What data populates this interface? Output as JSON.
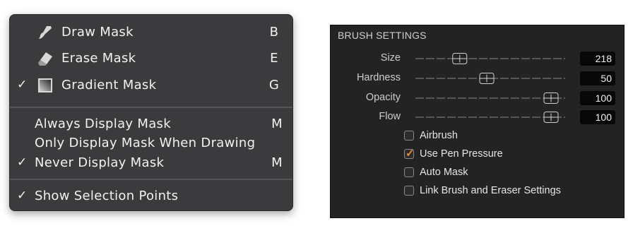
{
  "mask_menu": {
    "items": [
      {
        "label": "Draw Mask",
        "shortcut": "B",
        "checked": false,
        "icon": "brush-icon"
      },
      {
        "label": "Erase Mask",
        "shortcut": "E",
        "checked": false,
        "icon": "eraser-icon"
      },
      {
        "label": "Gradient Mask",
        "shortcut": "G",
        "checked": true,
        "icon": "gradient-icon"
      },
      {
        "label": "Always Display Mask",
        "shortcut": "M",
        "checked": false
      },
      {
        "label": "Only Display Mask When Drawing",
        "shortcut": "",
        "checked": false
      },
      {
        "label": "Never Display Mask",
        "shortcut": "M",
        "checked": true
      },
      {
        "label": "Show Selection Points",
        "shortcut": "",
        "checked": true
      }
    ],
    "check_glyph": "✓"
  },
  "brush_settings": {
    "title": "BRUSH SETTINGS",
    "sliders": [
      {
        "label": "Size",
        "value": "218",
        "level": 0.29
      },
      {
        "label": "Hardness",
        "value": "50",
        "level": 0.5
      },
      {
        "label": "Opacity",
        "value": "100",
        "level": 1.0
      },
      {
        "label": "Flow",
        "value": "100",
        "level": 1.0
      }
    ],
    "checkboxes": [
      {
        "label": "Airbrush",
        "checked": false
      },
      {
        "label": "Use Pen Pressure",
        "checked": true
      },
      {
        "label": "Auto Mask",
        "checked": false
      },
      {
        "label": "Link Brush and Eraser Settings",
        "checked": false
      }
    ],
    "accent_color": "#f08a24"
  }
}
